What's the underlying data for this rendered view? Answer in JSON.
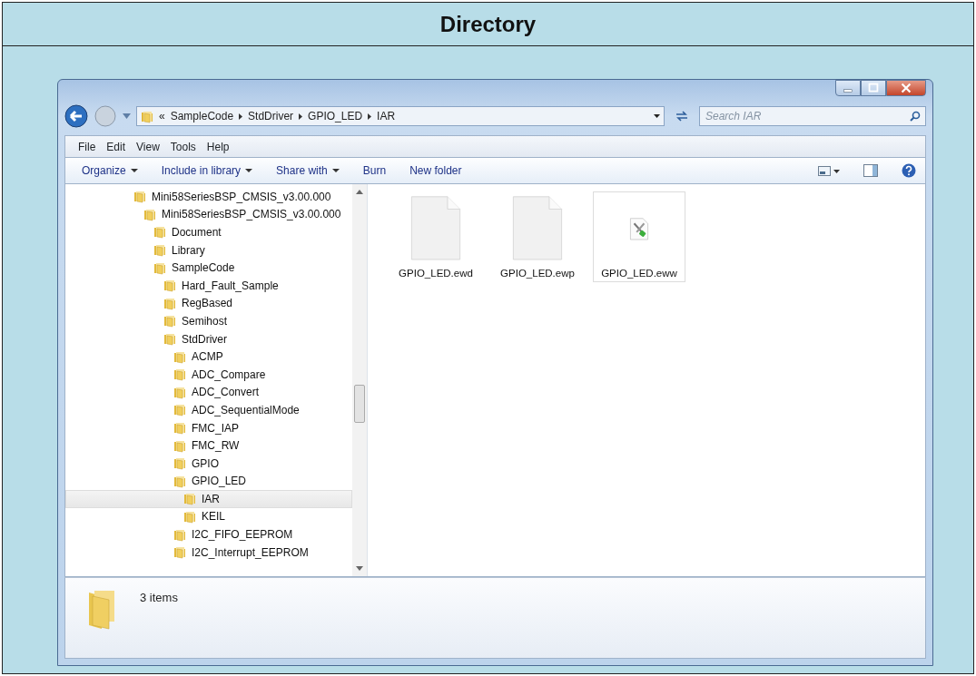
{
  "header": {
    "title": "Directory"
  },
  "address_bar": {
    "overflow": "«",
    "crumbs": [
      "SampleCode",
      "StdDriver",
      "GPIO_LED",
      "IAR"
    ]
  },
  "search": {
    "placeholder": "Search IAR"
  },
  "menu": [
    "File",
    "Edit",
    "View",
    "Tools",
    "Help"
  ],
  "toolbar": [
    {
      "label": "Organize",
      "dropdown": true
    },
    {
      "label": "Include in library",
      "dropdown": true
    },
    {
      "label": "Share with",
      "dropdown": true
    },
    {
      "label": "Burn",
      "dropdown": false
    },
    {
      "label": "New folder",
      "dropdown": false
    }
  ],
  "tree": [
    {
      "label": "Mini58SeriesBSP_CMSIS_v3.00.000",
      "selected": false,
      "children": [
        {
          "label": "Mini58SeriesBSP_CMSIS_v3.00.000",
          "selected": false,
          "children": [
            {
              "label": "Document",
              "selected": false
            },
            {
              "label": "Library",
              "selected": false
            },
            {
              "label": "SampleCode",
              "selected": false,
              "children": [
                {
                  "label": "Hard_Fault_Sample",
                  "selected": false
                },
                {
                  "label": "RegBased",
                  "selected": false
                },
                {
                  "label": "Semihost",
                  "selected": false
                },
                {
                  "label": "StdDriver",
                  "selected": false,
                  "children": [
                    {
                      "label": "ACMP",
                      "selected": false
                    },
                    {
                      "label": "ADC_Compare",
                      "selected": false
                    },
                    {
                      "label": "ADC_Convert",
                      "selected": false
                    },
                    {
                      "label": "ADC_SequentialMode",
                      "selected": false
                    },
                    {
                      "label": "FMC_IAP",
                      "selected": false
                    },
                    {
                      "label": "FMC_RW",
                      "selected": false
                    },
                    {
                      "label": "GPIO",
                      "selected": false
                    },
                    {
                      "label": "GPIO_LED",
                      "selected": false,
                      "children": [
                        {
                          "label": "IAR",
                          "selected": true
                        },
                        {
                          "label": "KEIL",
                          "selected": false
                        }
                      ]
                    },
                    {
                      "label": "I2C_FIFO_EEPROM",
                      "selected": false
                    },
                    {
                      "label": "I2C_Interrupt_EEPROM",
                      "selected": false
                    }
                  ]
                }
              ]
            }
          ]
        }
      ]
    }
  ],
  "files": [
    {
      "name": "GPIO_LED.ewd",
      "kind": "blank",
      "hovered": false
    },
    {
      "name": "GPIO_LED.ewp",
      "kind": "blank",
      "hovered": false
    },
    {
      "name": "GPIO_LED.eww",
      "kind": "workspace",
      "hovered": true
    }
  ],
  "status_bar": {
    "text": "3 items"
  }
}
